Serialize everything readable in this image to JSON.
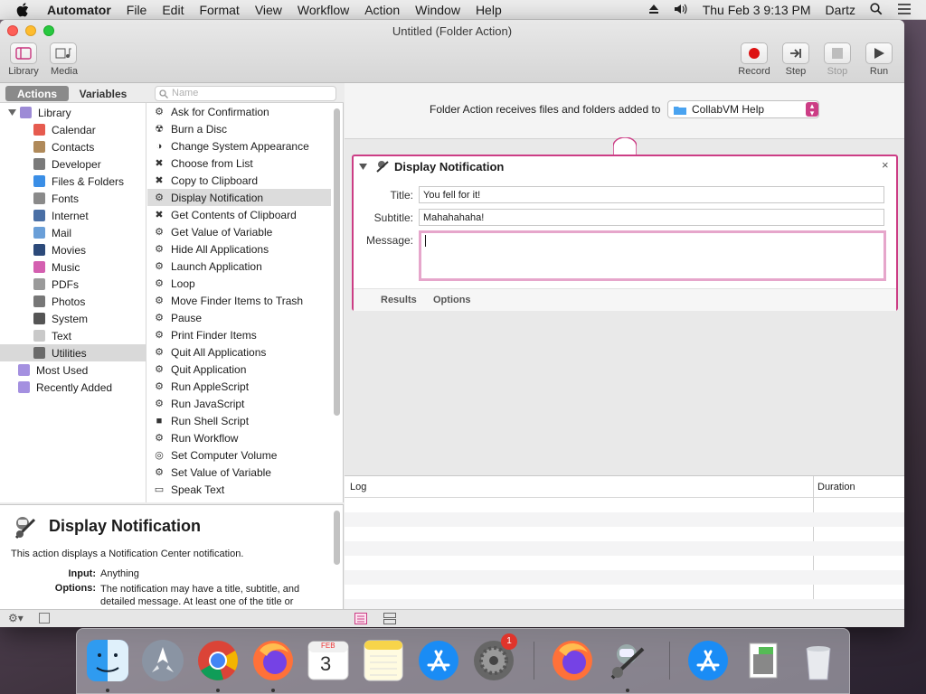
{
  "menubar": {
    "app_name": "Automator",
    "items": [
      "File",
      "Edit",
      "Format",
      "View",
      "Workflow",
      "Action",
      "Window",
      "Help"
    ],
    "datetime": "Thu Feb 3  9:13 PM",
    "user": "Dartz"
  },
  "window": {
    "title": "Untitled (Folder Action)"
  },
  "toolbar": {
    "library": "Library",
    "media": "Media",
    "record": "Record",
    "step": "Step",
    "stop": "Stop",
    "run": "Run"
  },
  "tabs": {
    "actions": "Actions",
    "variables": "Variables"
  },
  "search": {
    "placeholder": "Name"
  },
  "library": {
    "root": "Library",
    "items": [
      {
        "label": "Calendar",
        "icon": "calendar-icon",
        "color": "#e65b4f"
      },
      {
        "label": "Contacts",
        "icon": "contacts-icon",
        "color": "#b08a5a"
      },
      {
        "label": "Developer",
        "icon": "developer-icon",
        "color": "#7a7a7a"
      },
      {
        "label": "Files & Folders",
        "icon": "finder-icon",
        "color": "#3a8ee6"
      },
      {
        "label": "Fonts",
        "icon": "fonts-icon",
        "color": "#8a8a8a"
      },
      {
        "label": "Internet",
        "icon": "internet-icon",
        "color": "#4a6fa5"
      },
      {
        "label": "Mail",
        "icon": "mail-icon",
        "color": "#6a9fd8"
      },
      {
        "label": "Movies",
        "icon": "movies-icon",
        "color": "#2c4a7a"
      },
      {
        "label": "Music",
        "icon": "music-icon",
        "color": "#d45fb0"
      },
      {
        "label": "PDFs",
        "icon": "pdf-icon",
        "color": "#9a9a9a"
      },
      {
        "label": "Photos",
        "icon": "photos-icon",
        "color": "#777"
      },
      {
        "label": "System",
        "icon": "system-icon",
        "color": "#555"
      },
      {
        "label": "Text",
        "icon": "text-icon",
        "color": "#c9c9c9"
      },
      {
        "label": "Utilities",
        "icon": "utilities-icon",
        "color": "#6a6a6a"
      }
    ],
    "most_used": "Most Used",
    "recently_added": "Recently Added"
  },
  "actions": [
    "Ask for Confirmation",
    "Burn a Disc",
    "Change System Appearance",
    "Choose from List",
    "Copy to Clipboard",
    "Display Notification",
    "Get Contents of Clipboard",
    "Get Value of Variable",
    "Hide All Applications",
    "Launch Application",
    "Loop",
    "Move Finder Items to Trash",
    "Pause",
    "Print Finder Items",
    "Quit All Applications",
    "Quit Application",
    "Run AppleScript",
    "Run JavaScript",
    "Run Shell Script",
    "Run Workflow",
    "Set Computer Volume",
    "Set Value of Variable",
    "Speak Text"
  ],
  "selected_action": "Display Notification",
  "description": {
    "title": "Display Notification",
    "summary": "This action displays a Notification Center notification.",
    "input_label": "Input:",
    "input_value": "Anything",
    "options_label": "Options:",
    "options_value": "The notification may have a title, subtitle, and detailed message.  At least one of the title or"
  },
  "workflow": {
    "receives_label": "Folder Action receives files and folders added to",
    "folder": "CollabVM Help"
  },
  "card": {
    "title": "Display Notification",
    "title_label": "Title:",
    "title_value": "You fell for it!",
    "subtitle_label": "Subtitle:",
    "subtitle_value": "Mahahahaha!",
    "message_label": "Message:",
    "message_value": "",
    "results_tab": "Results",
    "options_tab": "Options"
  },
  "log": {
    "col_log": "Log",
    "col_duration": "Duration"
  },
  "dock": {
    "calendar_month": "FEB",
    "calendar_day": "3",
    "badge": "1"
  }
}
